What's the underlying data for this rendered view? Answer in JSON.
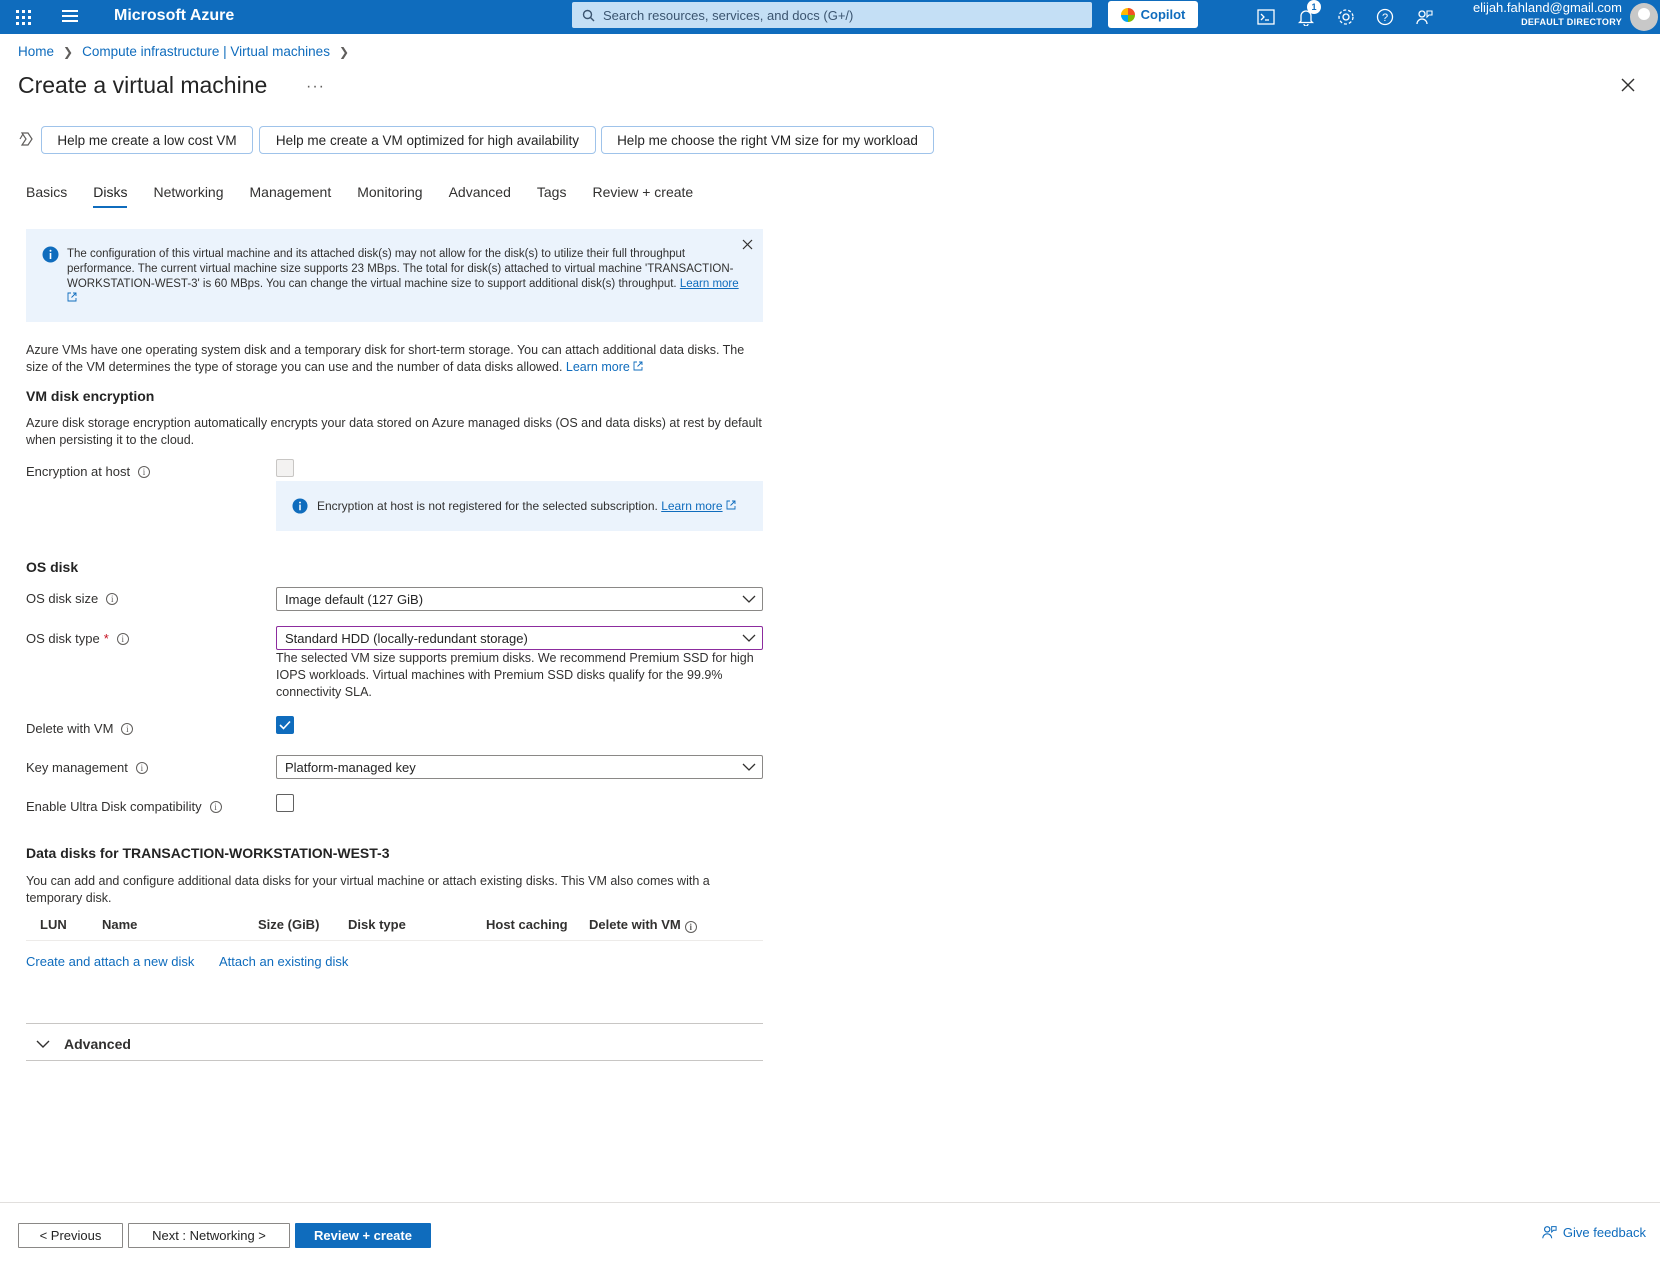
{
  "topbar": {
    "brand": "Microsoft Azure",
    "search_placeholder": "Search resources, services, and docs (G+/)",
    "copilot_label": "Copilot",
    "notifications_count": "1",
    "user_email": "elijah.fahland@gmail.com",
    "user_directory": "DEFAULT DIRECTORY"
  },
  "breadcrumb": {
    "items": [
      "Home",
      "Compute infrastructure | Virtual machines"
    ]
  },
  "page": {
    "title": "Create a virtual machine",
    "more": "···"
  },
  "copilot_prompts": [
    "Help me create a low cost VM",
    "Help me create a VM optimized for high availability",
    "Help me choose the right VM size for my workload"
  ],
  "tabs": [
    "Basics",
    "Disks",
    "Networking",
    "Management",
    "Monitoring",
    "Advanced",
    "Tags",
    "Review + create"
  ],
  "active_tab": "Disks",
  "banner": {
    "text": "The configuration of this virtual machine and its attached disk(s) may not allow for the disk(s) to utilize their full throughput performance. The current virtual machine size supports 23 MBps. The total for disk(s) attached to virtual machine 'TRANSACTION-WORKSTATION-WEST-3' is 60 MBps. You can change the virtual machine size to support additional disk(s) throughput.",
    "link": "Learn more"
  },
  "intro": {
    "text": "Azure VMs have one operating system disk and a temporary disk for short-term storage. You can attach additional data disks. The size of the VM determines the type of storage you can use and the number of data disks allowed.",
    "link": "Learn more"
  },
  "encryption": {
    "heading": "VM disk encryption",
    "description": "Azure disk storage encryption automatically encrypts your data stored on Azure managed disks (OS and data disks) at rest by default when persisting it to the cloud.",
    "host_label": "Encryption at host",
    "host_checked": false,
    "host_disabled": true,
    "note": "Encryption at host is not registered for the selected subscription.",
    "note_link": "Learn more"
  },
  "os_disk": {
    "heading": "OS disk",
    "size_label": "OS disk size",
    "size_value": "Image default (127 GiB)",
    "type_label": "OS disk type",
    "type_required": "*",
    "type_value": "Standard HDD (locally-redundant storage)",
    "type_helper": "The selected VM size supports premium disks. We recommend Premium SSD for high IOPS workloads. Virtual machines with Premium SSD disks qualify for the 99.9% connectivity SLA.",
    "delete_label": "Delete with VM",
    "delete_checked": true,
    "key_label": "Key management",
    "key_value": "Platform-managed key",
    "ultra_label": "Enable Ultra Disk compatibility",
    "ultra_checked": false
  },
  "data_disks": {
    "heading": "Data disks for TRANSACTION-WORKSTATION-WEST-3",
    "description": "You can add and configure additional data disks for your virtual machine or attach existing disks. This VM also comes with a temporary disk.",
    "columns": [
      "LUN",
      "Name",
      "Size (GiB)",
      "Disk type",
      "Host caching",
      "Delete with VM"
    ],
    "rows": [],
    "create_link": "Create and attach a new disk",
    "attach_link": "Attach an existing disk"
  },
  "advanced_section": {
    "label": "Advanced",
    "expanded": false
  },
  "footer": {
    "previous": "< Previous",
    "next": "Next : Networking >",
    "review": "Review + create",
    "feedback": "Give feedback"
  },
  "colors": {
    "azure_blue": "#0f6cbd",
    "info_bg": "#ebf3fc",
    "focus_border": "#8c2c9e"
  }
}
